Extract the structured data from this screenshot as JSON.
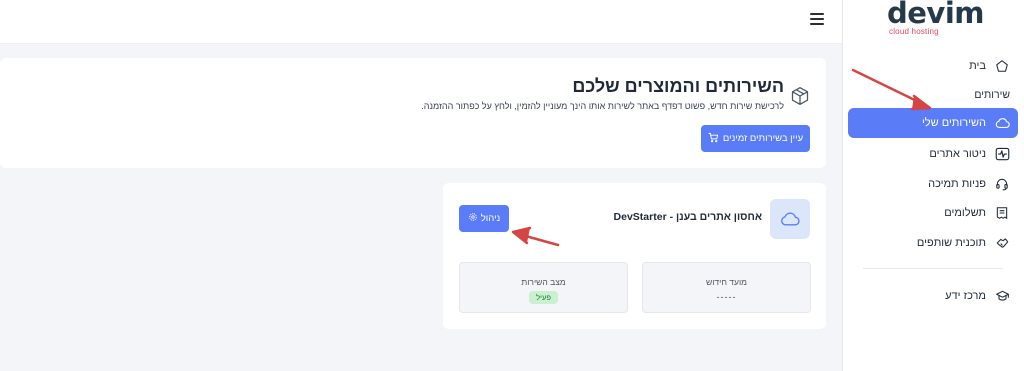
{
  "header": {
    "menu_icon": "hamburger-icon"
  },
  "brand": {
    "name": "devim",
    "tagline": "cloud hosting",
    "name_color": "#243a4a",
    "tagline_color": "#e0485a"
  },
  "sidebar": {
    "items": [
      {
        "label": "בית",
        "icon": "home-icon"
      },
      {
        "label": "השירותים שלי",
        "icon": "cloud-icon",
        "active": true
      },
      {
        "label": "ניטור אתרים",
        "icon": "activity-monitor-icon"
      },
      {
        "label": "פניות תמיכה",
        "icon": "headset-icon"
      },
      {
        "label": "תשלומים",
        "icon": "receipt-icon"
      },
      {
        "label": "תוכנית שותפים",
        "icon": "handshake-icon"
      },
      {
        "label": "מרכז ידע",
        "icon": "graduation-cap-icon"
      }
    ],
    "section_services": "שירותים"
  },
  "page": {
    "title": "השירותים והמוצרים שלכם",
    "description": "לרכישת שירות חדש, פשוט דפדף באתר לשירות אותו הינך מעוניין להזמין, ולחץ על כפתור ההזמנה.",
    "order_button": "עיין בשירותים זמינים",
    "title_icon": "box-icon"
  },
  "service": {
    "name": "אחסון אתרים בענן - DevStarter",
    "manage_button": "ניהול",
    "renewal_label": "מועד חידוש",
    "renewal_value": "-----",
    "status_label": "מצב השירות",
    "status_value": "פעיל",
    "icon": "cloud-icon"
  },
  "colors": {
    "accent": "#5b7cf7",
    "status_active_bg": "#c9f1cf",
    "annotation": "#d64545"
  }
}
